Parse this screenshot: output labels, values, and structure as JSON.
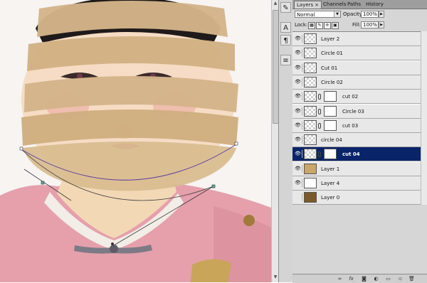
{
  "panel": {
    "tabs": [
      {
        "label": "Layers",
        "close": "×"
      },
      {
        "label": "Channels"
      },
      {
        "label": "Paths"
      },
      {
        "label": "History"
      }
    ],
    "blend_mode": "Normal",
    "opacity_label": "Opacity:",
    "opacity_value": "100%",
    "lock_label": "Lock:",
    "fill_label": "Fill:",
    "fill_value": "100%",
    "layers": [
      {
        "name": "Layer 2",
        "visible": true,
        "thumb": "transparent",
        "mask": false,
        "selected": false
      },
      {
        "name": "Circle 01",
        "visible": true,
        "thumb": "transparent",
        "mask": false,
        "selected": false
      },
      {
        "name": "Cut 01",
        "visible": true,
        "thumb": "transparent",
        "mask": false,
        "selected": false
      },
      {
        "name": "Circle 02",
        "visible": true,
        "thumb": "transparent",
        "mask": false,
        "selected": false
      },
      {
        "name": "cut 02",
        "visible": true,
        "thumb": "transparent",
        "mask": true,
        "selected": false
      },
      {
        "name": "Circle 03",
        "visible": true,
        "thumb": "transparent",
        "mask": true,
        "selected": false
      },
      {
        "name": "cut 03",
        "visible": true,
        "thumb": "transparent",
        "mask": true,
        "selected": false
      },
      {
        "name": "circle 04",
        "visible": true,
        "thumb": "transparent",
        "mask": false,
        "selected": false
      },
      {
        "name": "cut 04",
        "visible": true,
        "thumb": "transparent",
        "mask": true,
        "selected": true
      },
      {
        "name": "Layer 1",
        "visible": true,
        "thumb": "doll",
        "mask": false,
        "selected": false
      },
      {
        "name": "Layer 4",
        "visible": true,
        "thumb": "white",
        "mask": false,
        "selected": false
      },
      {
        "name": "Layer 0",
        "visible": false,
        "thumb": "photo",
        "mask": false,
        "selected": false
      }
    ],
    "bottom_icons": [
      "link-layers-icon",
      "fx-icon",
      "add-mask-icon",
      "adjustment-layer-icon",
      "new-group-icon",
      "new-layer-icon",
      "trash-icon"
    ]
  },
  "tools": [
    "brush-settings-icon",
    "character-icon",
    "paragraph-icon",
    "notes-icon"
  ],
  "colors": {
    "selection": "#0a246a",
    "band": "#d4b489",
    "shirt": "#e88ea0",
    "path": "#5e3fa0"
  }
}
